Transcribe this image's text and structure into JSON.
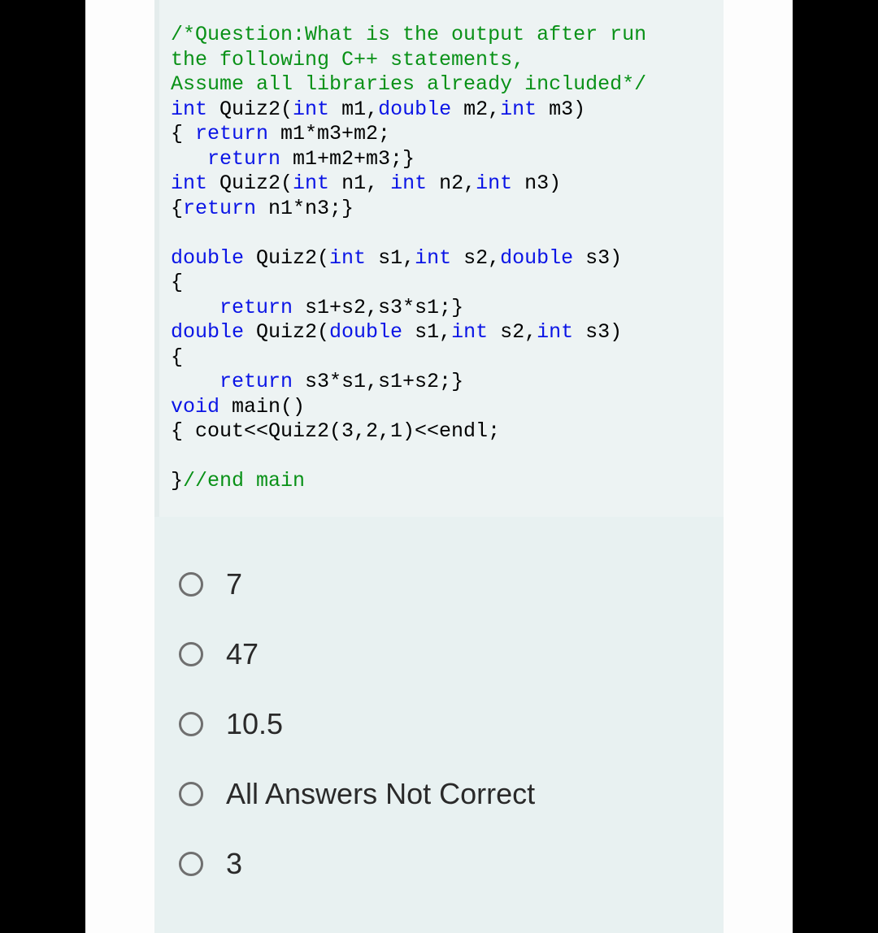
{
  "code": {
    "l1": "/*Question:What is the output after run",
    "l2": "the following C++ statements,",
    "l3": "Assume all libraries already included*/",
    "l4a": "int",
    "l4b": " Quiz2(",
    "l4c": "int",
    "l4d": " m1,",
    "l4e": "double",
    "l4f": " m2,",
    "l4g": "int",
    "l4h": " m3)",
    "l5a": "{ ",
    "l5b": "return",
    "l5c": " m1*m3+m2;",
    "l6a": "   ",
    "l6b": "return",
    "l6c": " m1+m2+m3;}",
    "l7a": "int",
    "l7b": " Quiz2(",
    "l7c": "int",
    "l7d": " n1, ",
    "l7e": "int",
    "l7f": " n2,",
    "l7g": "int",
    "l7h": " n3)",
    "l8a": "{",
    "l8b": "return",
    "l8c": " n1*n3;}",
    "l9": "",
    "l10a": "double",
    "l10b": " Quiz2(",
    "l10c": "int",
    "l10d": " s1,",
    "l10e": "int",
    "l10f": " s2,",
    "l10g": "double",
    "l10h": " s3)",
    "l11": "{",
    "l12a": "    ",
    "l12b": "return",
    "l12c": " s1+s2,s3*s1;}",
    "l13a": "double",
    "l13b": " Quiz2(",
    "l13c": "double",
    "l13d": " s1,",
    "l13e": "int",
    "l13f": " s2,",
    "l13g": "int",
    "l13h": " s3)",
    "l14": "{",
    "l15a": "    ",
    "l15b": "return",
    "l15c": " s3*s1,s1+s2;}",
    "l16a": "void",
    "l16b": " main()",
    "l17": "{ cout<<Quiz2(3,2,1)<<endl;",
    "l18": "",
    "l19a": "}",
    "l19b": "//end main"
  },
  "options": [
    {
      "label": "7"
    },
    {
      "label": "47"
    },
    {
      "label": "10.5"
    },
    {
      "label": "All Answers Not Correct"
    },
    {
      "label": "3"
    }
  ]
}
